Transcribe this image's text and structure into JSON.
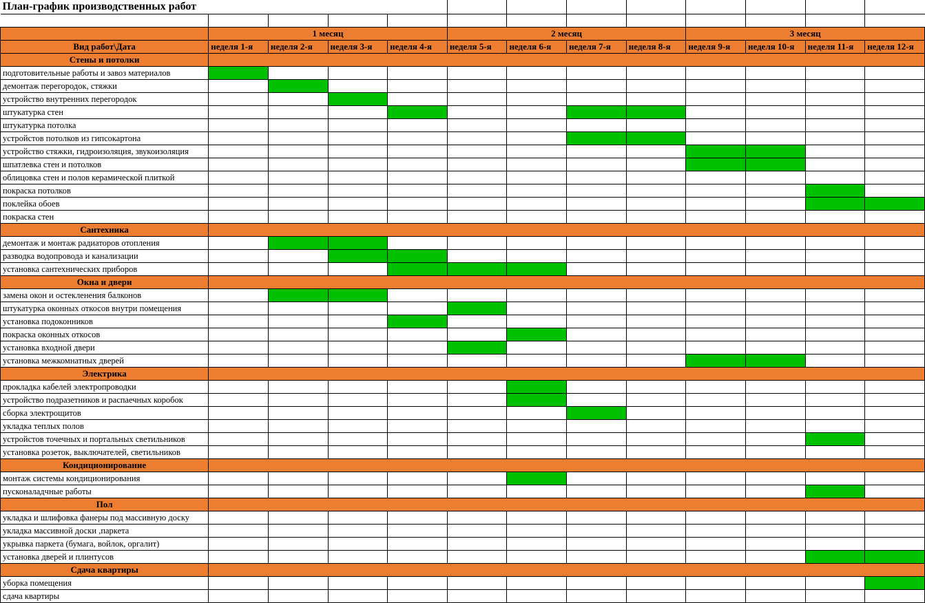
{
  "title": "План-график производственных работ",
  "header_row_col0": "Вид работ\\Дата",
  "months": [
    "1 месяц",
    "2 месяц",
    "3 месяц"
  ],
  "weeks": [
    "неделя 1-я",
    "неделя 2-я",
    "неделя 3-я",
    "неделя 4-я",
    "неделя 5-я",
    "неделя 6-я",
    "неделя 7-я",
    "неделя 8-я",
    "неделя 9-я",
    "неделя 10-я",
    "неделя 11-я",
    "неделя 12-я"
  ],
  "sections": [
    {
      "title": "Стены и потолки",
      "rows": [
        {
          "label": "подготовительные работы и завоз материалов",
          "cells": [
            1,
            0,
            0,
            0,
            0,
            0,
            0,
            0,
            0,
            0,
            0,
            0
          ]
        },
        {
          "label": "демонтаж перегородок, стяжки",
          "cells": [
            0,
            1,
            0,
            0,
            0,
            0,
            0,
            0,
            0,
            0,
            0,
            0
          ]
        },
        {
          "label": "устройство внутренних перегородок",
          "cells": [
            0,
            0,
            1,
            0,
            0,
            0,
            0,
            0,
            0,
            0,
            0,
            0
          ]
        },
        {
          "label": "штукатурка стен",
          "cells": [
            0,
            0,
            0,
            1,
            0,
            0,
            1,
            1,
            0,
            0,
            0,
            0
          ]
        },
        {
          "label": "штукатурка потолка",
          "cells": [
            0,
            0,
            0,
            0,
            0,
            0,
            0,
            0,
            0,
            0,
            0,
            0
          ]
        },
        {
          "label": "устройстов потолков из гипсокартона",
          "cells": [
            0,
            0,
            0,
            0,
            0,
            0,
            1,
            1,
            0,
            0,
            0,
            0
          ]
        },
        {
          "label": "устройство стяжки, гидроизоляция, звукоизоляция",
          "cells": [
            0,
            0,
            0,
            0,
            0,
            0,
            0,
            0,
            1,
            1,
            0,
            0
          ]
        },
        {
          "label": "шпатлевка стен и потолков",
          "cells": [
            0,
            0,
            0,
            0,
            0,
            0,
            0,
            0,
            1,
            1,
            0,
            0
          ]
        },
        {
          "label": "облицовка стен и полов керамической плиткой",
          "cells": [
            0,
            0,
            0,
            0,
            0,
            0,
            0,
            0,
            0,
            0,
            0,
            0
          ]
        },
        {
          "label": "покраска потолков",
          "cells": [
            0,
            0,
            0,
            0,
            0,
            0,
            0,
            0,
            0,
            0,
            1,
            0
          ]
        },
        {
          "label": "поклейка обоев",
          "cells": [
            0,
            0,
            0,
            0,
            0,
            0,
            0,
            0,
            0,
            0,
            1,
            1
          ]
        },
        {
          "label": "покраска стен",
          "cells": [
            0,
            0,
            0,
            0,
            0,
            0,
            0,
            0,
            0,
            0,
            0,
            0
          ]
        }
      ]
    },
    {
      "title": "Сантехника",
      "rows": [
        {
          "label": "демонтаж и монтаж радиаторов отопления",
          "cells": [
            0,
            1,
            1,
            0,
            0,
            0,
            0,
            0,
            0,
            0,
            0,
            0
          ]
        },
        {
          "label": "разводка водопровода и канализации",
          "cells": [
            0,
            0,
            1,
            1,
            0,
            0,
            0,
            0,
            0,
            0,
            0,
            0
          ]
        },
        {
          "label": "установка сантехнических приборов",
          "cells": [
            0,
            0,
            0,
            1,
            1,
            1,
            0,
            0,
            0,
            0,
            0,
            0
          ]
        }
      ]
    },
    {
      "title": "Окна и двери",
      "rows": [
        {
          "label": "замена окон и остекленения балконов",
          "cells": [
            0,
            1,
            1,
            0,
            0,
            0,
            0,
            0,
            0,
            0,
            0,
            0
          ]
        },
        {
          "label": "штукатурка оконных откосов внутри помещения",
          "cells": [
            0,
            0,
            0,
            0,
            1,
            0,
            0,
            0,
            0,
            0,
            0,
            0
          ]
        },
        {
          "label": "установка подоконников",
          "cells": [
            0,
            0,
            0,
            1,
            0,
            0,
            0,
            0,
            0,
            0,
            0,
            0
          ]
        },
        {
          "label": "покраска оконных откосов",
          "cells": [
            0,
            0,
            0,
            0,
            0,
            1,
            0,
            0,
            0,
            0,
            0,
            0
          ]
        },
        {
          "label": "установка входной двери",
          "cells": [
            0,
            0,
            0,
            0,
            1,
            0,
            0,
            0,
            0,
            0,
            0,
            0
          ]
        },
        {
          "label": "установка межкомнатных дверей",
          "cells": [
            0,
            0,
            0,
            0,
            0,
            0,
            0,
            0,
            1,
            1,
            0,
            0
          ]
        }
      ]
    },
    {
      "title": "Электрика",
      "rows": [
        {
          "label": "прокладка кабелей электропроводки",
          "cells": [
            0,
            0,
            0,
            0,
            0,
            1,
            0,
            0,
            0,
            0,
            0,
            0
          ]
        },
        {
          "label": "устройство подразетников и распаечных коробок",
          "cells": [
            0,
            0,
            0,
            0,
            0,
            1,
            0,
            0,
            0,
            0,
            0,
            0
          ]
        },
        {
          "label": "сборка электрощитов",
          "cells": [
            0,
            0,
            0,
            0,
            0,
            0,
            1,
            0,
            0,
            0,
            0,
            0
          ]
        },
        {
          "label": "укладка теплых полов",
          "cells": [
            0,
            0,
            0,
            0,
            0,
            0,
            0,
            0,
            0,
            0,
            0,
            0
          ]
        },
        {
          "label": "устройстов точечных и портальных светильников",
          "cells": [
            0,
            0,
            0,
            0,
            0,
            0,
            0,
            0,
            0,
            0,
            1,
            0
          ]
        },
        {
          "label": "установка розеток, выключателей, светильников",
          "cells": [
            0,
            0,
            0,
            0,
            0,
            0,
            0,
            0,
            0,
            0,
            0,
            0
          ]
        }
      ]
    },
    {
      "title": "Кондиционирование",
      "rows": [
        {
          "label": "монтаж системы кондиционирования",
          "cells": [
            0,
            0,
            0,
            0,
            0,
            1,
            0,
            0,
            0,
            0,
            0,
            0
          ]
        },
        {
          "label": "пусконаладчные работы",
          "cells": [
            0,
            0,
            0,
            0,
            0,
            0,
            0,
            0,
            0,
            0,
            1,
            0
          ]
        }
      ]
    },
    {
      "title": "Пол",
      "rows": [
        {
          "label": "укладка и шлифовка фанеры под массивную доску",
          "cells": [
            0,
            0,
            0,
            0,
            0,
            0,
            0,
            0,
            0,
            0,
            0,
            0
          ]
        },
        {
          "label": "укладка массивной доски ,паркета",
          "cells": [
            0,
            0,
            0,
            0,
            0,
            0,
            0,
            0,
            0,
            0,
            0,
            0
          ]
        },
        {
          "label": "укрывка паркета (бумага, войлок, оргалит)",
          "cells": [
            0,
            0,
            0,
            0,
            0,
            0,
            0,
            0,
            0,
            0,
            0,
            0
          ]
        },
        {
          "label": "установка дверей и плинтусов",
          "cells": [
            0,
            0,
            0,
            0,
            0,
            0,
            0,
            0,
            0,
            0,
            1,
            1
          ]
        }
      ]
    },
    {
      "title": "Сдача квартиры",
      "rows": [
        {
          "label": "уборка помещения",
          "cells": [
            0,
            0,
            0,
            0,
            0,
            0,
            0,
            0,
            0,
            0,
            0,
            1
          ]
        },
        {
          "label": "сдача квартиры",
          "cells": [
            0,
            0,
            0,
            0,
            0,
            0,
            0,
            0,
            0,
            0,
            0,
            0
          ]
        }
      ]
    }
  ]
}
